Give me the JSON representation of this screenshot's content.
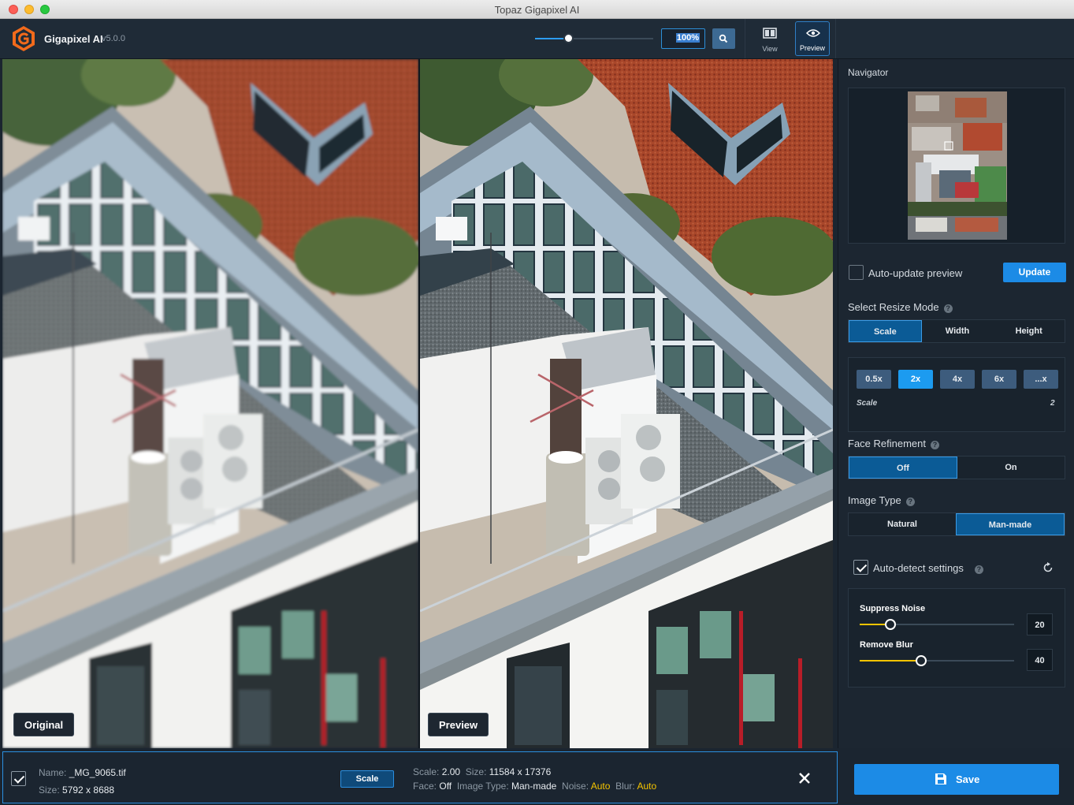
{
  "window": {
    "title": "Topaz Gigapixel AI"
  },
  "header": {
    "app_name": "Gigapixel AI",
    "version": "v5.0.0",
    "zoom_value": "100%",
    "zoom_slider_fraction": 0.28,
    "view_label": "View",
    "preview_label": "Preview",
    "icons": {
      "logo": "gigapixel-logo-icon",
      "zoom": "magnifier-icon",
      "view": "split-view-icon",
      "preview": "eye-icon"
    }
  },
  "panes": {
    "original_label": "Original",
    "preview_label": "Preview"
  },
  "panel": {
    "navigator_title": "Navigator",
    "auto_update_label": "Auto-update preview",
    "auto_update_checked": false,
    "update_button": "Update",
    "resize_mode_title": "Select Resize Mode",
    "resize_modes": [
      "Scale",
      "Width",
      "Height"
    ],
    "resize_mode_active": "Scale",
    "scale_buttons": [
      "0.5x",
      "2x",
      "4x",
      "6x",
      "...x"
    ],
    "scale_active": "2x",
    "scale_caption": "Scale",
    "scale_value": "2",
    "face_refinement_title": "Face Refinement",
    "face_options": [
      "Off",
      "On"
    ],
    "face_active": "Off",
    "image_type_title": "Image Type",
    "image_types": [
      "Natural",
      "Man-made"
    ],
    "image_type_active": "Man-made",
    "auto_detect_label": "Auto-detect settings",
    "auto_detect_checked": true,
    "suppress_noise_label": "Suppress Noise",
    "suppress_noise_value": "20",
    "suppress_noise_fraction": 0.2,
    "remove_blur_label": "Remove Blur",
    "remove_blur_value": "40",
    "remove_blur_fraction": 0.4
  },
  "bottom": {
    "checked": true,
    "name_label": "Name:",
    "name_value": "_MG_9065.tif",
    "size_label": "Size:",
    "size_value": "5792 x 8688",
    "scale_button": "Scale",
    "scale_label": "Scale:",
    "scale_value": "2.00",
    "out_size_label": "Size:",
    "out_size_value": "11584 x 17376",
    "face_label": "Face:",
    "face_value": "Off",
    "image_type_label": "Image Type:",
    "image_type_value": "Man-made",
    "noise_label": "Noise:",
    "noise_value": "Auto",
    "blur_label": "Blur:",
    "blur_value": "Auto",
    "save_button": "Save",
    "colors": {
      "accent": "#1c8be6",
      "auto": "#f5c400"
    }
  }
}
